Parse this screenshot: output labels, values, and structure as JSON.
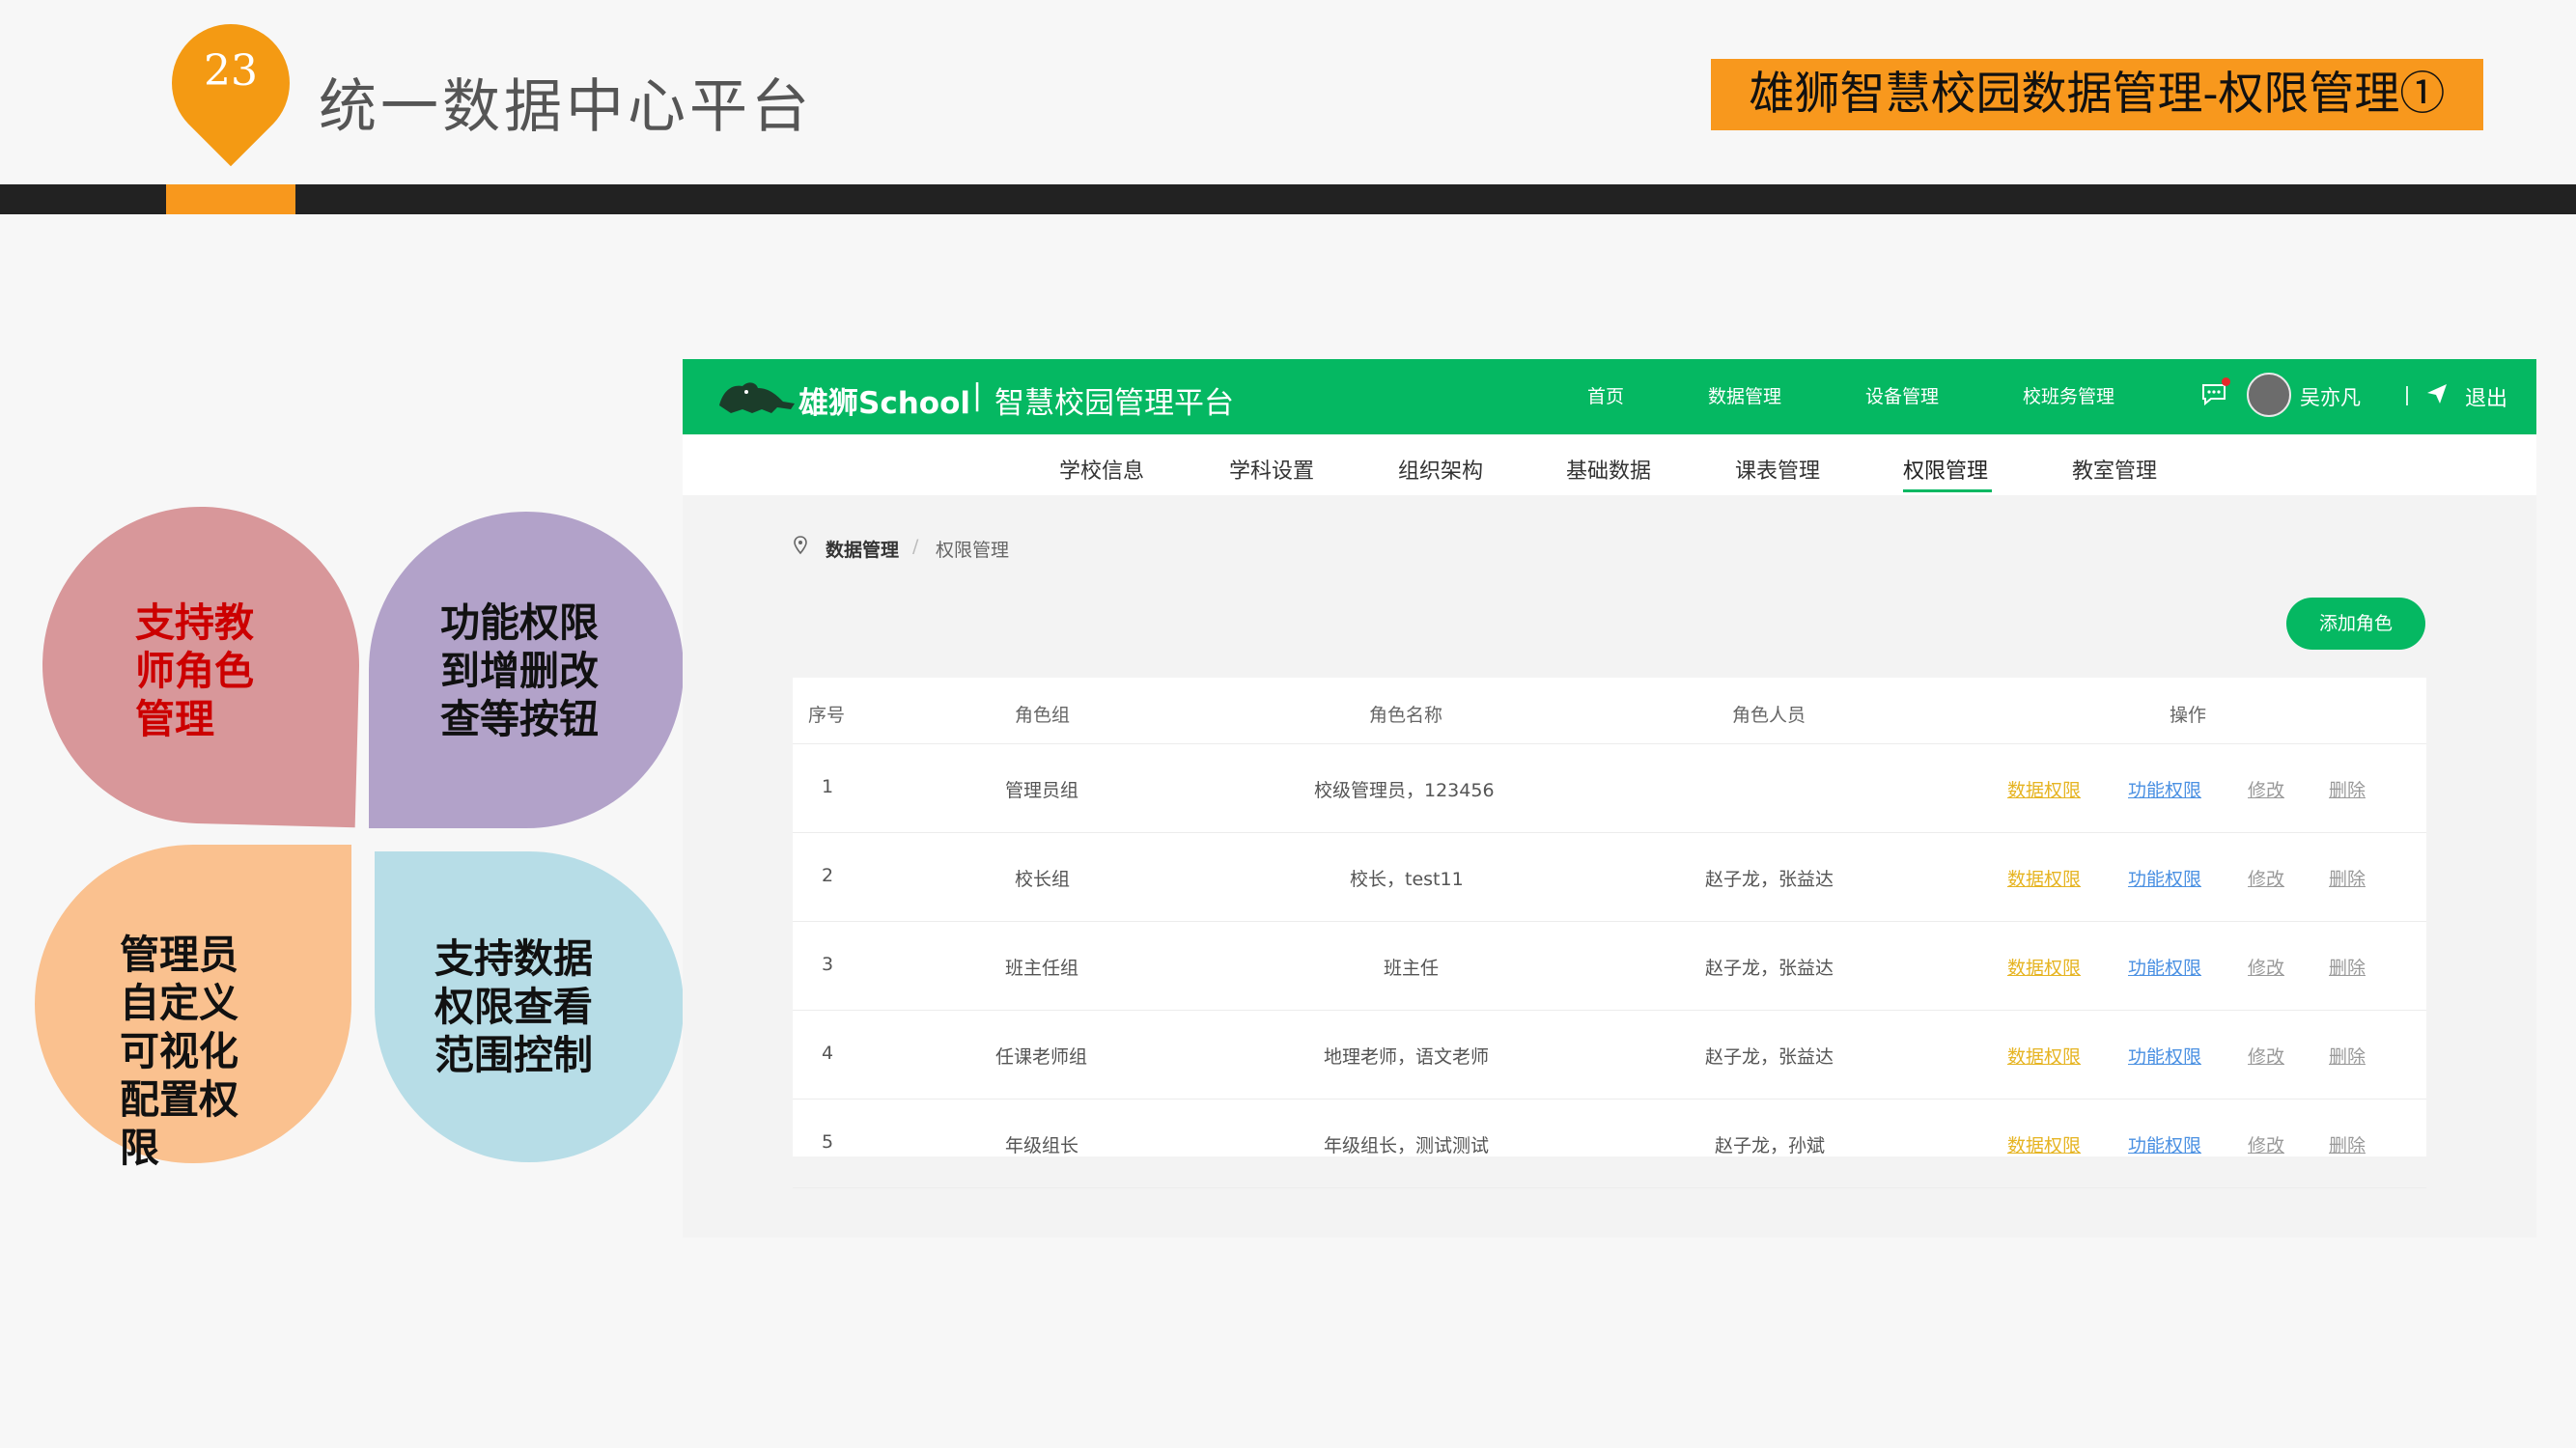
{
  "slide": {
    "page_number": "23",
    "title": "统一数据中心平台",
    "top_right_label": "雄狮智慧校园数据管理-权限管理①",
    "colors": {
      "accent": "#f8981d",
      "dark_bar": "#222222"
    }
  },
  "features": [
    {
      "text": "支持教\n师角色\n管理",
      "color": "#d8979a",
      "text_color": "#cc0000"
    },
    {
      "text": "功能权限\n到增删改\n查等按钮",
      "color": "#b2a2c9",
      "text_color": "#111111"
    },
    {
      "text": "管理员\n自定义\n可视化\n配置权\n限",
      "color": "#fac18f",
      "text_color": "#111111"
    },
    {
      "text": "支持数据\n权限查看\n范围控制",
      "color": "#b7dde7",
      "text_color": "#111111"
    }
  ],
  "app": {
    "brand_name": "雄狮School",
    "brand_separator": "|",
    "brand_sub": "智慧校园管理平台",
    "brand_color": "#05b862",
    "top_nav": [
      "首页",
      "数据管理",
      "设备管理",
      "校班务管理"
    ],
    "user_name": "吴亦凡",
    "logout_label": "退出",
    "icons": [
      "logo-lion-icon",
      "chat-icon",
      "avatar",
      "send-icon",
      "location-pin-icon"
    ],
    "sub_nav": {
      "items": [
        "学校信息",
        "学科设置",
        "组织架构",
        "基础数据",
        "课表管理",
        "权限管理",
        "教室管理"
      ],
      "active": "权限管理"
    },
    "breadcrumb": {
      "level1": "数据管理",
      "separator": "/",
      "level2": "权限管理"
    },
    "add_role_label": "添加角色",
    "table": {
      "headers": [
        "序号",
        "角色组",
        "角色名称",
        "角色人员",
        "操作"
      ],
      "rows": [
        {
          "index": "1",
          "group": "管理员组",
          "name": "校级管理员，123456",
          "members": ""
        },
        {
          "index": "2",
          "group": "校长组",
          "name": "校长，test11",
          "members": "赵子龙，张益达"
        },
        {
          "index": "3",
          "group": "班主任组",
          "name": "班主任",
          "members": "赵子龙，张益达"
        },
        {
          "index": "4",
          "group": "任课老师组",
          "name": "地理老师，语文老师",
          "members": "赵子龙，张益达"
        },
        {
          "index": "5",
          "group": "年级组长",
          "name": "年级组长，测试测试",
          "members": "赵子龙，孙斌"
        }
      ],
      "actions": {
        "data_perm": "数据权限",
        "func_perm": "功能权限",
        "edit": "修改",
        "delete": "删除"
      }
    }
  }
}
